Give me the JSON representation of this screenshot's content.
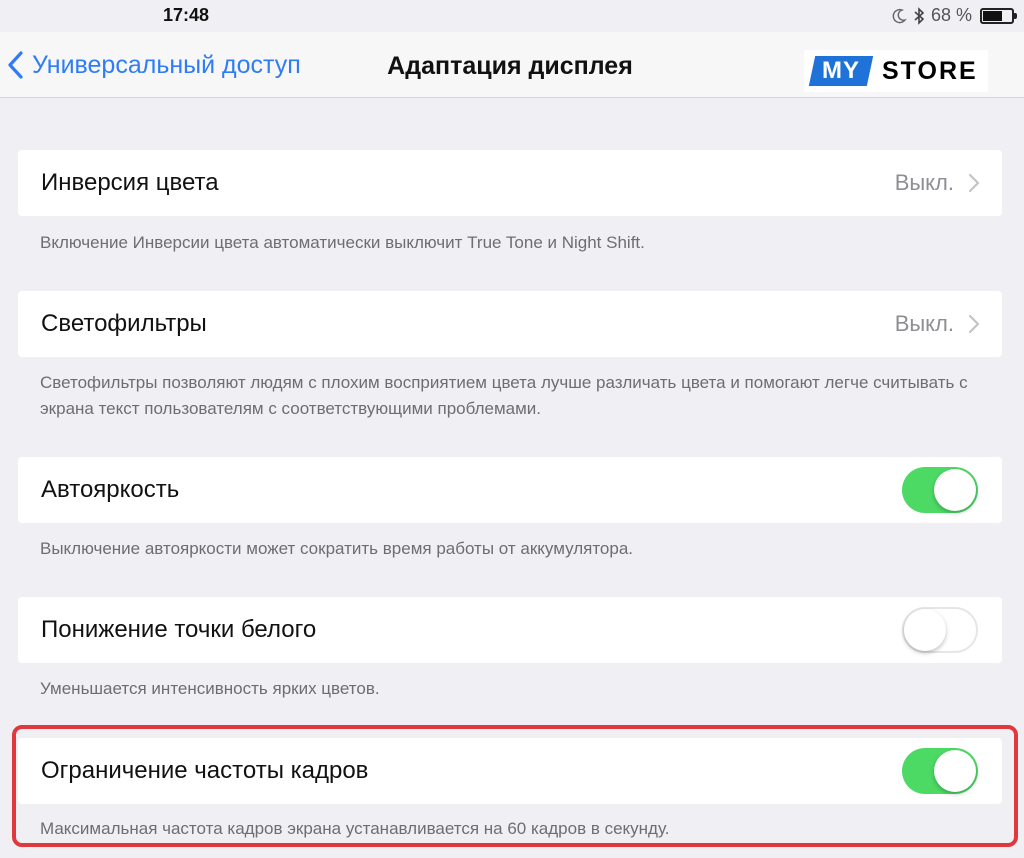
{
  "status_bar": {
    "time": "17:48",
    "battery_text": "68 %",
    "battery_level": 0.68,
    "icons": [
      "moon-icon",
      "bluetooth-icon",
      "battery-icon"
    ]
  },
  "nav": {
    "back_label": "Универсальный доступ",
    "title": "Адаптация дисплея",
    "accent_color": "#2f7cf6"
  },
  "logo": {
    "part1": "MY",
    "part2": "STORE",
    "brand_color": "#1f73d8"
  },
  "settings": {
    "invert": {
      "label": "Инверсия цвета",
      "value": "Выкл.",
      "footer": "Включение Инверсии цвета автоматически выключит True Tone и Night Shift."
    },
    "filters": {
      "label": "Светофильтры",
      "value": "Выкл.",
      "footer": "Светофильтры позволяют людям с плохим восприятием цвета лучше различать цвета и помогают легче считывать с экрана текст пользователям с соответствующими проблемами."
    },
    "autobrightness": {
      "label": "Автояркость",
      "enabled": true,
      "footer": "Выключение автояркости может сократить время работы от аккумулятора."
    },
    "white_point": {
      "label": "Понижение точки белого",
      "enabled": false,
      "footer": "Уменьшается интенсивность ярких цветов."
    },
    "frame_rate": {
      "label": "Ограничение частоты кадров",
      "enabled": true,
      "footer": "Максимальная частота кадров экрана устанавливается на 60 кадров в секунду."
    }
  },
  "colors": {
    "toggle_on": "#4cd964",
    "highlight": "#e0383c",
    "background": "#efeff4"
  }
}
